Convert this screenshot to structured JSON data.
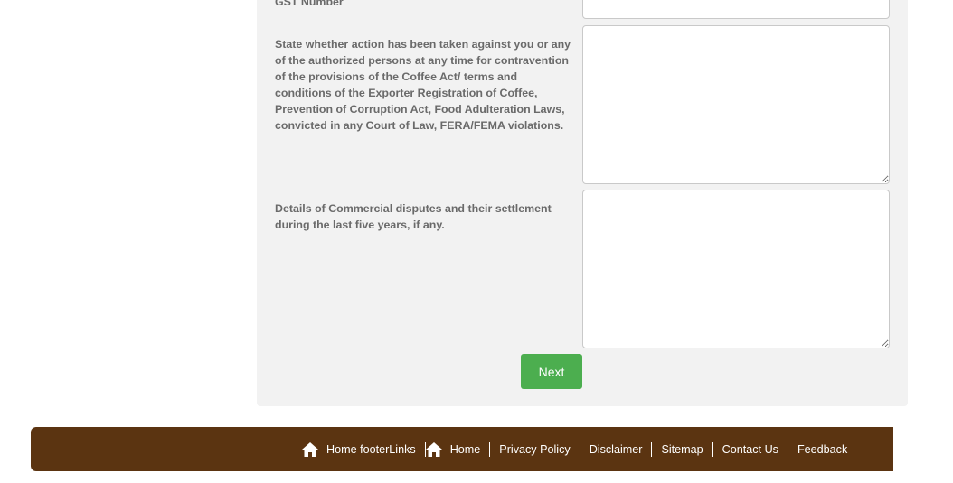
{
  "form": {
    "gst_label": "GST Number",
    "gst_value": "",
    "action_label": "State whether action has been taken against you or any of the authorized persons at any time for contravention of the provisions of the Coffee Act/ terms and conditions of the Exporter Registration of Coffee, Prevention of Corruption Act, Food Adulteration Laws, convicted in any Court of Law, FERA/FEMA violations.",
    "action_value": "",
    "disputes_label": "Details of Commercial disputes and their settlement during the last five years, if any.",
    "disputes_value": "",
    "next_label": "Next"
  },
  "footer": {
    "home_footerlinks_label": "Home footerLinks",
    "links": {
      "home": "Home",
      "privacy_policy": "Privacy Policy",
      "disclaimer": "Disclaimer",
      "sitemap": "Sitemap",
      "contact_us": "Contact Us",
      "feedback": "Feedback"
    },
    "icons": {
      "home": "home-icon"
    },
    "colors": {
      "background": "#5b3411",
      "text": "#ffffff"
    }
  },
  "colors": {
    "panel_background": "#f2f2f2",
    "label_text": "#6a6a6a",
    "next_button": "#4cae4f"
  }
}
